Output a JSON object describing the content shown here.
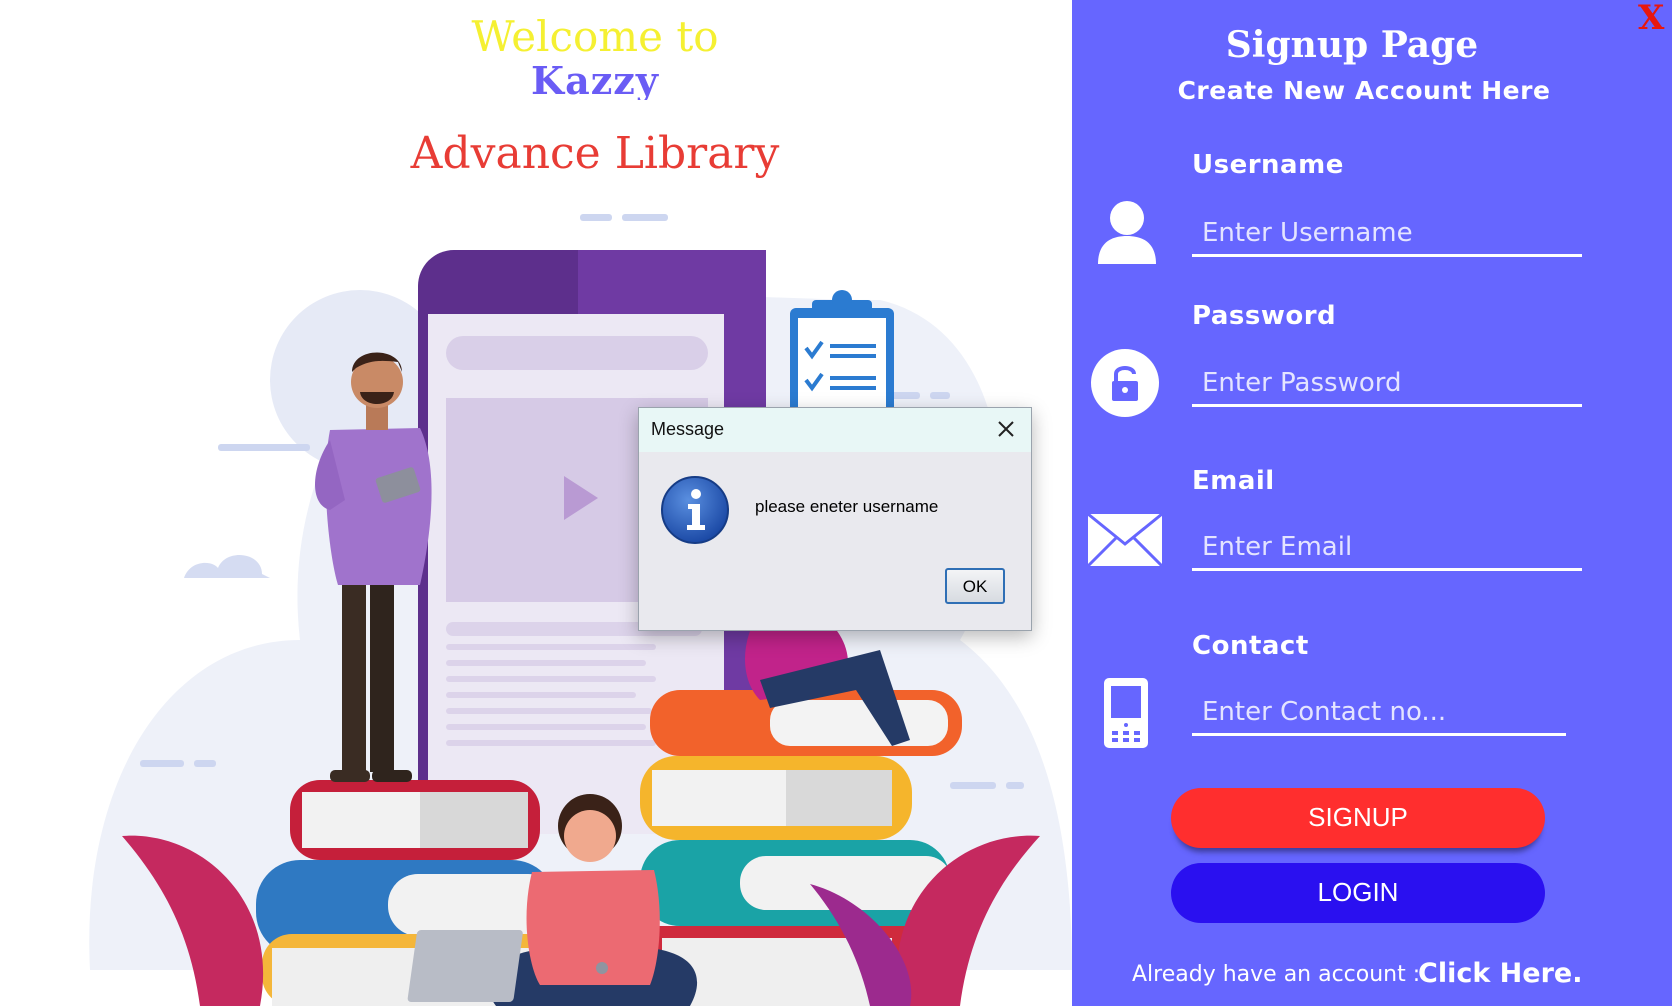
{
  "left": {
    "welcome": "Welcome to",
    "brand": "Kazzy",
    "subtitle": "Advance Library"
  },
  "panel": {
    "close_label": "X",
    "title": "Signup Page",
    "subtitle": "Create New Account Here",
    "fields": [
      {
        "label": "Username",
        "placeholder": "Enter Username",
        "icon": "user-icon"
      },
      {
        "label": "Password",
        "placeholder": "Enter Password",
        "icon": "lock-icon"
      },
      {
        "label": "Email",
        "placeholder": "Enter Email",
        "icon": "envelope-icon"
      },
      {
        "label": "Contact",
        "placeholder": "Enter Contact no...",
        "icon": "phone-icon"
      }
    ],
    "signup_label": "SIGNUP",
    "login_label": "LOGIN",
    "already_text": "Already have an account :",
    "click_here": "Click Here."
  },
  "dialog": {
    "title": "Message",
    "message": "please eneter username",
    "ok_label": "OK",
    "icon": "info-icon"
  },
  "colors": {
    "panel_bg": "#6666ff",
    "signup": "#ff2e2e",
    "login": "#2a10f0",
    "close_x": "#e8170f",
    "welcome": "#f5f032",
    "subtitle": "#e83c35"
  }
}
